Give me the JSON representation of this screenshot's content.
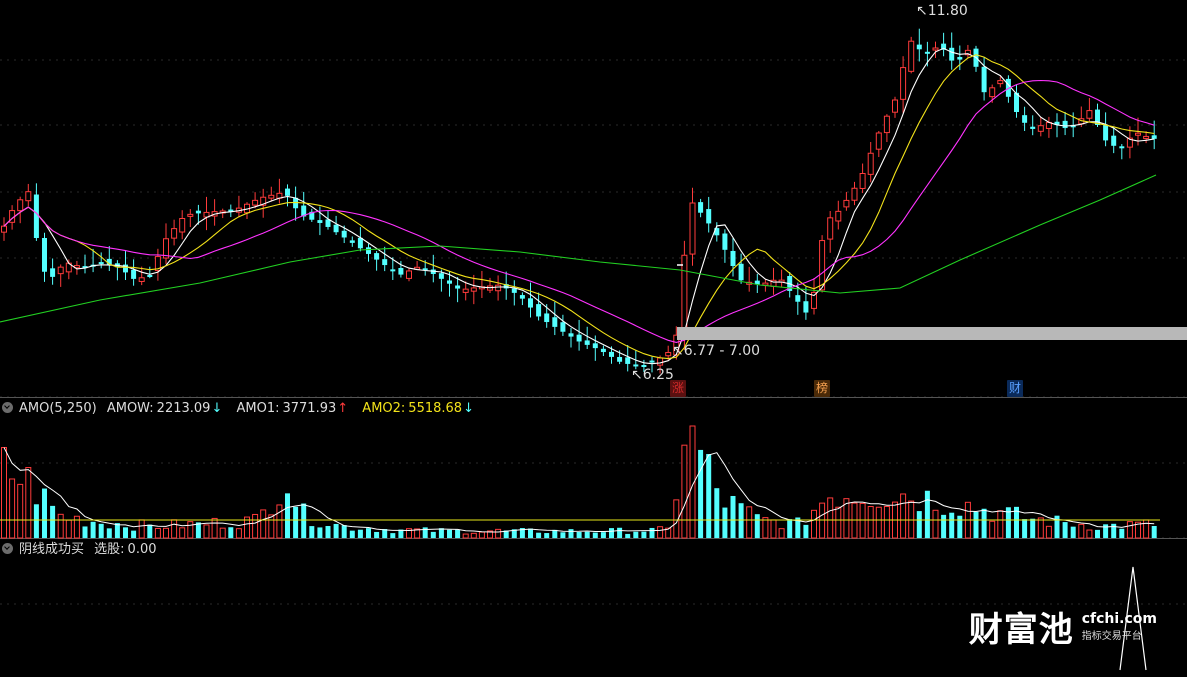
{
  "colors": {
    "up": "#ff3b3b",
    "down": "#54ffff",
    "ma5": "#ffffff",
    "ma10": "#f2e21a",
    "ma20": "#ff33ff",
    "ma60": "#22d022",
    "amo1": "#ffffff",
    "amo2": "#e8e81a",
    "amow_text": "#ddd",
    "amo2_text": "#f2e21a",
    "band": "#b8b8b8"
  },
  "price_panel": {
    "high_label": "11.80",
    "low_label": "6.25",
    "band_label": "6.77 - 7.00",
    "band_icon": "range-band",
    "markers": [
      {
        "text": "涨",
        "color": "#d02a2a",
        "bg": "#5a1010"
      },
      {
        "text": "榜",
        "color": "#f4a050",
        "bg": "#4a2a08"
      },
      {
        "text": "财",
        "color": "#5aa0ff",
        "bg": "#0a2a5a"
      }
    ]
  },
  "amo_panel": {
    "indicator": "AMO(5,250)",
    "amow_label": "AMOW:",
    "amow_value": "2213.09",
    "amow_arrow": "↓",
    "amo1_label": "AMO1:",
    "amo1_value": "3771.93",
    "amo1_arrow": "↑",
    "amo2_label": "AMO2:",
    "amo2_value": "5518.68",
    "amo2_arrow": "↓"
  },
  "signal_panel": {
    "indicator": "阴线成功买",
    "select_label": "选股:",
    "select_value": "0.00"
  },
  "watermark": {
    "brand": "财富池",
    "url": "cfchi.com",
    "sub": "指标交易平台"
  },
  "chart_data": {
    "type": "candlestick",
    "series": [
      {
        "name": "AMOW",
        "unit": "volume"
      },
      {
        "name": "AMO1",
        "unit": "moving average"
      },
      {
        "name": "AMO2",
        "unit": "moving average"
      }
    ],
    "price_high": 11.8,
    "price_low": 6.25,
    "highlight_range": [
      6.77,
      7.0
    ],
    "amow": 2213.09,
    "amo1": 3771.93,
    "amo2": 5518.68,
    "select": 0.0
  }
}
